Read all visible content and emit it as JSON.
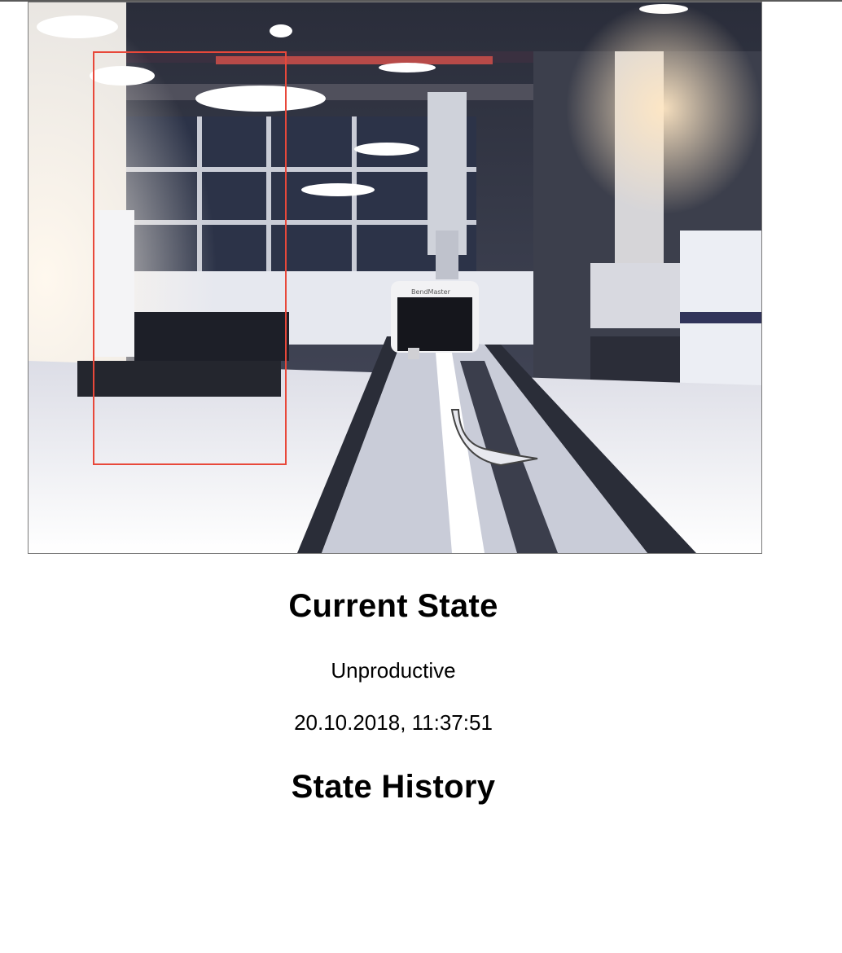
{
  "current_state": {
    "heading": "Current State",
    "value": "Unproductive",
    "timestamp": "20.10.2018, 11:37:51"
  },
  "state_history": {
    "heading": "State History"
  },
  "camera": {
    "machine_label": "BendMaster",
    "detection_color": "#e8483a"
  }
}
